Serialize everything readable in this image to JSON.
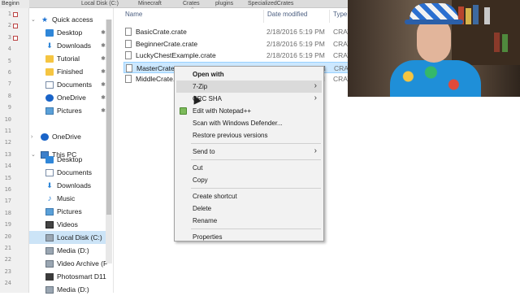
{
  "window": {
    "tab_title": "Beginn",
    "breadcrumb_parts": [
      "Local Disk (C:)",
      "Minecraft",
      "Crates",
      "plugins",
      "SpecializedCrates"
    ]
  },
  "gutter": {
    "line_numbers": [
      "1",
      "2",
      "3",
      "4",
      "5",
      "6",
      "7",
      "8",
      "9",
      "10",
      "11",
      "12",
      "13",
      "14",
      "15",
      "16",
      "17",
      "18",
      "19",
      "20",
      "21",
      "22",
      "23",
      "24"
    ]
  },
  "nav": {
    "quick_access_label": "Quick access",
    "quick_access_items": [
      {
        "label": "Desktop",
        "icon": "desktop-icon",
        "pinned": true
      },
      {
        "label": "Downloads",
        "icon": "downloads-icon",
        "pinned": true
      },
      {
        "label": "Tutorial",
        "icon": "folder-icon",
        "pinned": true
      },
      {
        "label": "Finished",
        "icon": "folder-icon",
        "pinned": true
      },
      {
        "label": "Documents",
        "icon": "documents-icon",
        "pinned": true
      },
      {
        "label": "OneDrive",
        "icon": "onedrive-icon",
        "pinned": true
      },
      {
        "label": "Pictures",
        "icon": "pictures-icon",
        "pinned": true
      }
    ],
    "onedrive_label": "OneDrive",
    "this_pc_label": "This PC",
    "this_pc_items": [
      {
        "label": "Desktop",
        "icon": "desktop-icon"
      },
      {
        "label": "Documents",
        "icon": "documents-icon"
      },
      {
        "label": "Downloads",
        "icon": "downloads-icon"
      },
      {
        "label": "Music",
        "icon": "music-icon"
      },
      {
        "label": "Pictures",
        "icon": "pictures-icon"
      },
      {
        "label": "Videos",
        "icon": "videos-icon"
      },
      {
        "label": "Local Disk (C:)",
        "icon": "drive-icon",
        "selected": true
      },
      {
        "label": "Media (D:)",
        "icon": "drive-icon"
      },
      {
        "label": "Video Archive (F",
        "icon": "drive-icon"
      },
      {
        "label": "Photosmart D11",
        "icon": "printer-icon"
      },
      {
        "label": "Media (D:)",
        "icon": "drive-icon"
      }
    ]
  },
  "files": {
    "columns": {
      "name": "Name",
      "date": "Date modified",
      "type": "Type"
    },
    "rows": [
      {
        "name": "BasicCrate.crate",
        "date": "2/18/2016 5:19 PM",
        "type": "CRAT"
      },
      {
        "name": "BeginnerCrate.crate",
        "date": "2/18/2016 5:19 PM",
        "type": "CRAT"
      },
      {
        "name": "LuckyChestExample.crate",
        "date": "2/18/2016 5:19 PM",
        "type": "CRAT"
      },
      {
        "name": "MasterCrate.crate",
        "date": "2/18/2016 5:19 PM",
        "type": "CRAT",
        "selected": true
      },
      {
        "name": "MiddleCrate.crate",
        "date": "2/18/2016 5:19 PM",
        "type": "CRAT"
      }
    ]
  },
  "context_menu": {
    "items": [
      {
        "label": "Open with",
        "bold": true
      },
      {
        "label": "7-Zip",
        "submenu": true,
        "hover": true
      },
      {
        "label": "CRC SHA",
        "submenu": true
      },
      {
        "label": "Edit with Notepad++",
        "icon": "notepad-plus-plus-icon"
      },
      {
        "label": "Scan with Windows Defender..."
      },
      {
        "label": "Restore previous versions"
      },
      {
        "separator": true
      },
      {
        "label": "Send to",
        "submenu": true
      },
      {
        "separator": true
      },
      {
        "label": "Cut"
      },
      {
        "label": "Copy"
      },
      {
        "separator": true
      },
      {
        "label": "Create shortcut"
      },
      {
        "label": "Delete"
      },
      {
        "label": "Rename"
      },
      {
        "separator": true
      },
      {
        "label": "Properties"
      }
    ]
  },
  "colors": {
    "selection": "#cce8ff",
    "nav_selected": "#cce4f7",
    "menu_background": "#f2f2f2",
    "menu_hover": "#dadada",
    "header_text": "#4d6082"
  }
}
